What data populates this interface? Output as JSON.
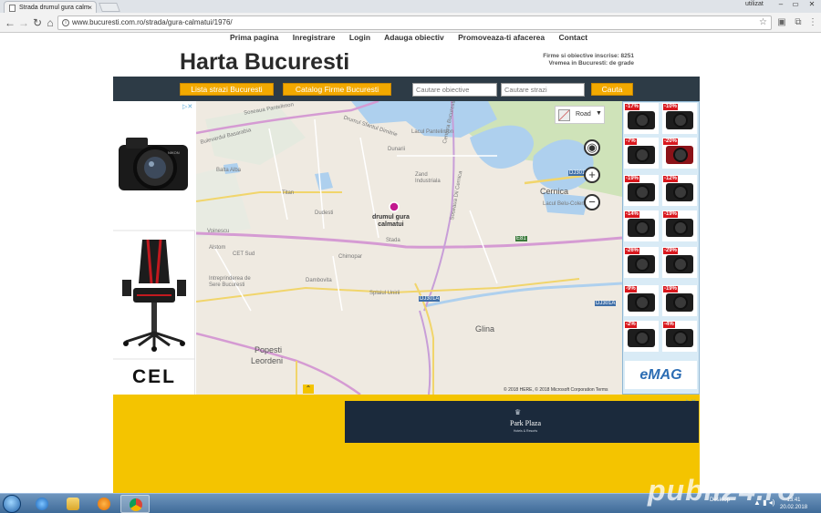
{
  "browser": {
    "tab_title": "Strada drumul gura calm",
    "url": "www.bucuresti.com.ro/strada/gura-calmatui/1976/",
    "window_user": "utilizat"
  },
  "nav": {
    "items": [
      "Prima pagina",
      "Inregistrare",
      "Login",
      "Adauga obiectiv",
      "Promoveaza-ti afacerea",
      "Contact"
    ]
  },
  "header": {
    "title": "Harta Bucuresti",
    "stats_line1": "Firme si obiective inscrise: 8251",
    "stats_line2": "Vremea in Bucuresti: de grade"
  },
  "toolbar": {
    "lista_strazi": "Lista strazi Bucuresti",
    "catalog_firme": "Catalog Firme Bucuresti",
    "search_obiective_placeholder": "Cautare obiective",
    "search_strazi_placeholder": "Cautare strazi",
    "search_button": "Cauta"
  },
  "map": {
    "style_label": "Road",
    "pin_label_line1": "drumul gura",
    "pin_label_line2": "calmatui",
    "cities": [
      {
        "name": "Cernica"
      },
      {
        "name": "Glina"
      },
      {
        "name": "Popesti"
      },
      {
        "name": "Leordeni"
      }
    ],
    "labels": [
      "Lacul Pantelimon",
      "Lacul Belu-Colentina",
      "Centura Bucuresti",
      "Drumul Sfantul Dimitrie",
      "Soseaua Pantelimon",
      "Bulevardul Basarabia",
      "Dambovita",
      "Splaiul Unirii",
      "Titan",
      "Balta Alba",
      "Dudesti",
      "Chimopar",
      "Stada",
      "CET Sud",
      "Alstom",
      "Voinescu",
      "Intreprinderea de Sere Bucuresti",
      "Zand Industriala",
      "Dunarii",
      "DJ301",
      "DJ301A",
      "E81",
      "Soseaua Dii Cernica"
    ],
    "attribution": "© 2018 HERE, © 2018 Microsoft Corporation  Terms",
    "zoom_in": "+",
    "zoom_out": "−"
  },
  "ads": {
    "left_brand": "CEL",
    "right_brand": "eMAG",
    "discounts": [
      "-17%",
      "-10%",
      "-7%",
      "-20%",
      "-19%",
      "-12%",
      "-14%",
      "-19%",
      "-26%",
      "-29%",
      "-9%",
      "-19%",
      "-2%",
      "-4%"
    ],
    "park_plaza": "Park Plaza",
    "park_plaza_sub": "Hotels & Resorts"
  },
  "taskbar": {
    "desktop_label": "Desktop",
    "time": "13:41",
    "date": "20.02.2018"
  },
  "watermark": "publi24.ro",
  "colors": {
    "accent_orange": "#f2a900",
    "dark_bar": "#2d3b46",
    "ad_yellow": "#f4c400",
    "emag_blue": "#2b6cb3",
    "pin_magenta": "#c2188f"
  }
}
